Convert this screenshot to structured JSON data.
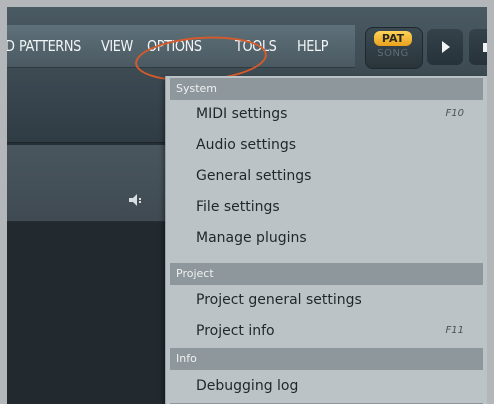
{
  "menubar": {
    "items": [
      "D",
      "PATTERNS",
      "VIEW",
      "OPTIONS",
      "TOOLS",
      "HELP"
    ]
  },
  "transport": {
    "pat_label": "PAT",
    "song_label": "SONG",
    "play_icon": "play-icon",
    "stop_icon": "stop-icon"
  },
  "options_menu": {
    "sections": [
      {
        "header": "System",
        "items": [
          {
            "label": "MIDI settings",
            "shortcut": "F10"
          },
          {
            "label": "Audio settings",
            "shortcut": ""
          },
          {
            "label": "General settings",
            "shortcut": ""
          },
          {
            "label": "File settings",
            "shortcut": ""
          },
          {
            "label": "Manage plugins",
            "shortcut": ""
          }
        ]
      },
      {
        "header": "Project",
        "items": [
          {
            "label": "Project general settings",
            "shortcut": ""
          },
          {
            "label": "Project info",
            "shortcut": "F11"
          }
        ]
      },
      {
        "header": "Info",
        "items": [
          {
            "label": "Debugging log",
            "shortcut": ""
          }
        ]
      }
    ]
  },
  "colors": {
    "highlight_ellipse": "#d75a2a",
    "pat_accent": "#f3b530",
    "menu_background": "#bcc3c6",
    "section_header": "#8e979c"
  }
}
